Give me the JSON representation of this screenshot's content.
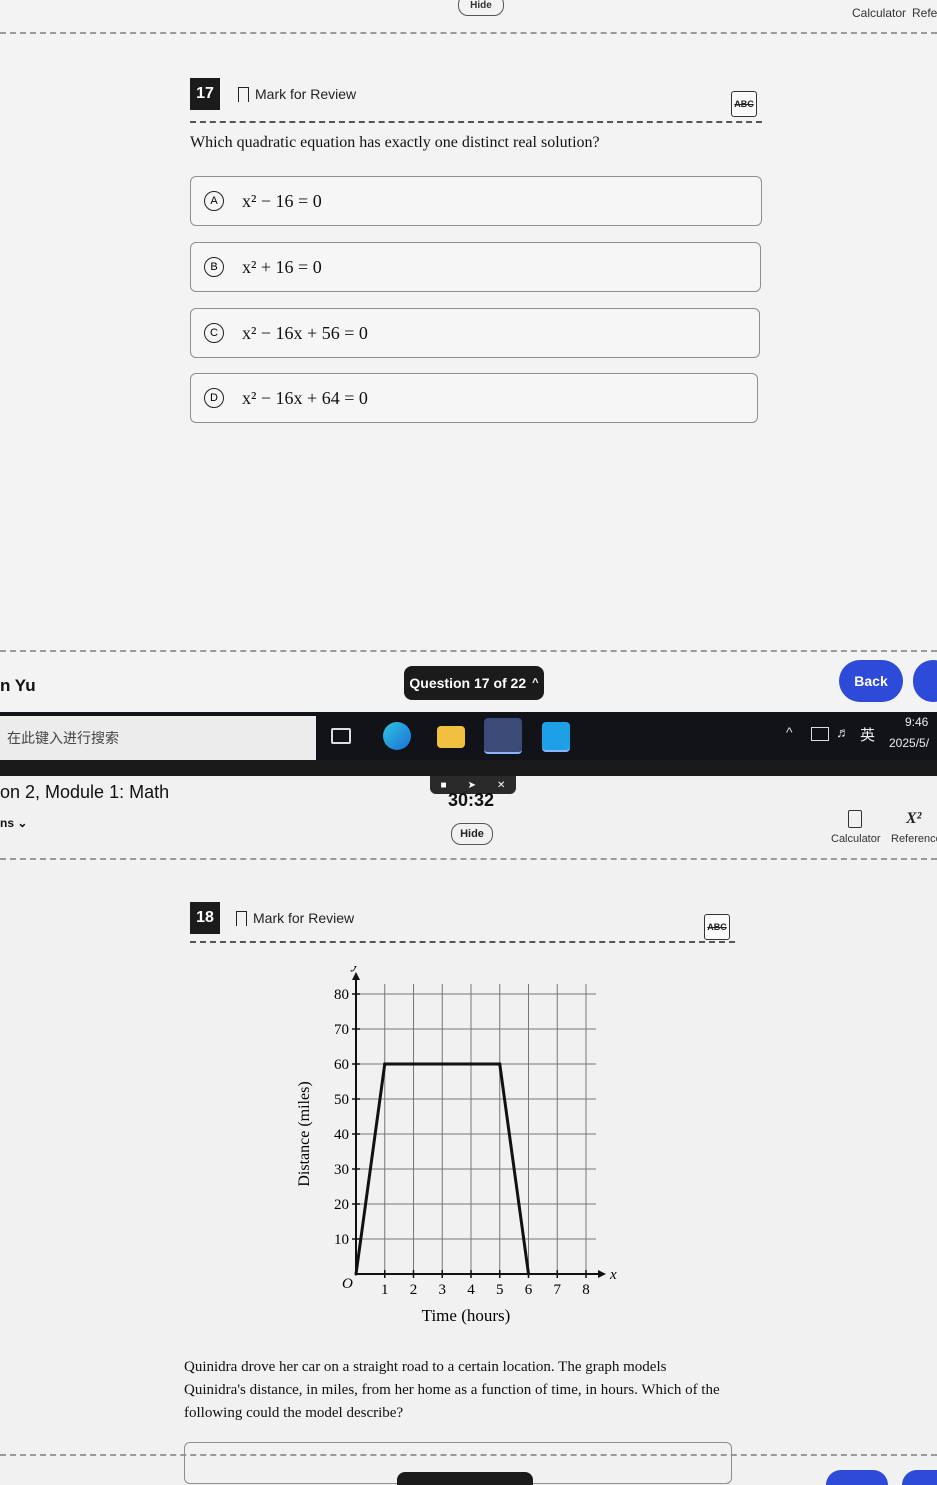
{
  "top": {
    "hide_label": "Hide",
    "calculator_label": "Calculator",
    "reference_label": "Refe",
    "question": {
      "number": "17",
      "mark_label": "Mark for Review",
      "prompt": "Which quadratic equation has exactly one distinct real solution?",
      "choices": [
        {
          "letter": "A",
          "text": "x² − 16 = 0"
        },
        {
          "letter": "B",
          "text": "x² + 16 = 0"
        },
        {
          "letter": "C",
          "text": "x² − 16x + 56 = 0"
        },
        {
          "letter": "D",
          "text": "x² − 16x + 64 = 0"
        }
      ]
    },
    "footer": {
      "student_name": "n Yu",
      "question_nav": "Question 17 of 22",
      "back_label": "Back"
    }
  },
  "taskbar": {
    "search_text": "在此键入进行搜索",
    "ime_label": "英",
    "time": "9:46",
    "date": "2025/5/"
  },
  "bottom": {
    "section_title": "on 2, Module 1: Math",
    "directions_label": "ns",
    "timer": "30:32",
    "hide_label": "Hide",
    "calculator_label": "Calculator",
    "reference_label": "Reference",
    "question": {
      "number": "18",
      "mark_label": "Mark for Review",
      "prompt": "Quinidra drove her car on a straight road to a certain location. The graph models Quinidra's distance, in miles, from her home as a function of time, in hours. Which of the following could the model describe?"
    }
  },
  "chart_data": {
    "type": "line",
    "x": [
      0,
      1,
      5,
      6
    ],
    "y": [
      0,
      60,
      60,
      0
    ],
    "xlabel": "Time (hours)",
    "ylabel": "Distance (miles)",
    "x_axis_letter": "x",
    "y_axis_letter": "y",
    "x_ticks": [
      1,
      2,
      3,
      4,
      5,
      6,
      7,
      8
    ],
    "y_ticks": [
      10,
      20,
      30,
      40,
      50,
      60,
      70,
      80
    ],
    "origin_label": "O",
    "xlim": [
      0,
      8
    ],
    "ylim": [
      0,
      80
    ],
    "grid": true
  },
  "colors": {
    "back_button": "#2d4ad8",
    "nav_pill": "#1b1b1b",
    "taskbar": "#111318"
  }
}
